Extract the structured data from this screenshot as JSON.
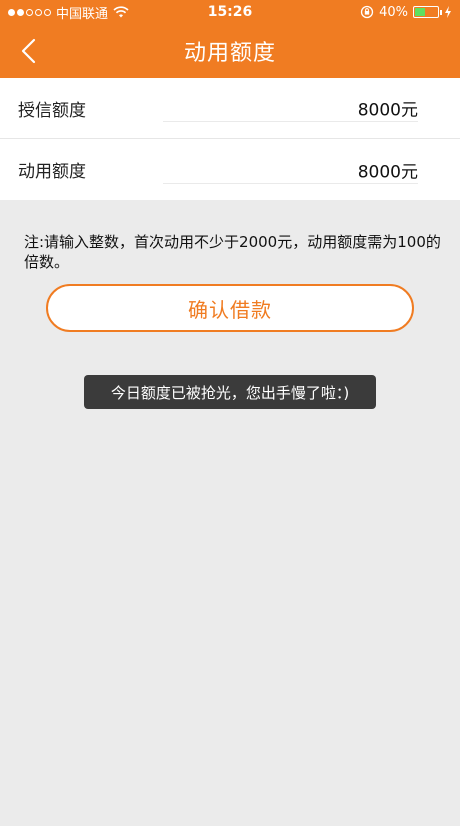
{
  "status_bar": {
    "carrier": "中国联通",
    "time": "15:26",
    "battery": "40%"
  },
  "nav": {
    "title": "动用额度",
    "back_icon": "chevron-left-icon"
  },
  "rows": [
    {
      "label": "授信额度",
      "value": "8000元"
    },
    {
      "label": "动用额度",
      "value": "8000元"
    }
  ],
  "note": "注:请输入整数，首次动用不少于2000元，动用额度需为100的倍数。",
  "confirm_label": "确认借款",
  "toast": "今日额度已被抢光，您出手慢了啦：)",
  "colors": {
    "brand": "#f07c22",
    "background": "#ebebeb",
    "toast": "#3b3b3b"
  }
}
